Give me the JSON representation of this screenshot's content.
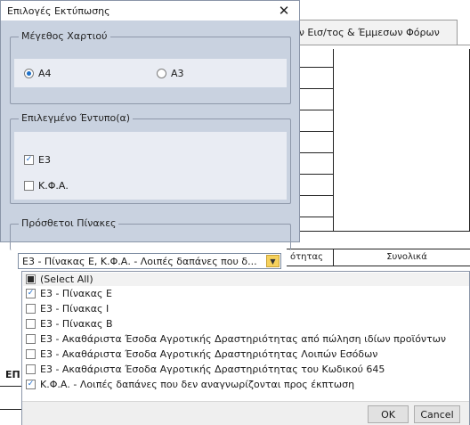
{
  "background": {
    "tab_label": "ον Εισ/τος & Έμμεσων Φόρων",
    "header_left": "ότητας",
    "header_right": "Συνολικά",
    "left_fragment": "ΕΠ"
  },
  "dialog": {
    "title": "Επιλογές Εκτύπωσης",
    "close_icon": "close-icon",
    "paper_size": {
      "legend": "Μέγεθος Χαρτιού",
      "options": [
        {
          "label": "A4",
          "selected": true
        },
        {
          "label": "A3",
          "selected": false
        }
      ]
    },
    "selected_forms": {
      "legend": "Επιλεγμένο Έντυπο(α)",
      "items": [
        {
          "label": "Ε3",
          "checked": true
        },
        {
          "label": "Κ.Φ.Α.",
          "checked": false
        }
      ]
    },
    "additional_tables": {
      "legend": "Πρόσθετοι Πίνακες",
      "combo_value": "Ε3 - Πίνακας Ε, Κ.Φ.Α. - Λοιπές δαπάνες που δ...",
      "combo_icon": "chevron-down-icon"
    }
  },
  "dropdown": {
    "select_all": "(Select All)",
    "items": [
      {
        "label": "Ε3 - Πίνακας Ε",
        "checked": true
      },
      {
        "label": "Ε3 - Πίνακας Ι",
        "checked": false
      },
      {
        "label": "Ε3 - Πίνακας Β",
        "checked": false
      },
      {
        "label": "Ε3 - Ακαθάριστα Έσοδα Αγροτικής Δραστηριότητας από πώληση ιδίων προϊόντων",
        "checked": false
      },
      {
        "label": "Ε3 - Ακαθάριστα Έσοδα Αγροτικής Δραστηριότητας Λοιπών Εσόδων",
        "checked": false
      },
      {
        "label": "Ε3 - Ακαθάριστα Έσοδα Αγροτικής Δραστηριότητας του Κωδικού 645",
        "checked": false
      },
      {
        "label": "Κ.Φ.Α. - Λοιπές δαπάνες που δεν αναγνωρίζονται προς έκπτωση",
        "checked": true
      }
    ],
    "ok_label": "OK",
    "cancel_label": "Cancel"
  },
  "colors": {
    "dialog_bg": "#c9d2e0",
    "combo_button": "#f6d15c",
    "check_accent": "#1e70c8"
  }
}
